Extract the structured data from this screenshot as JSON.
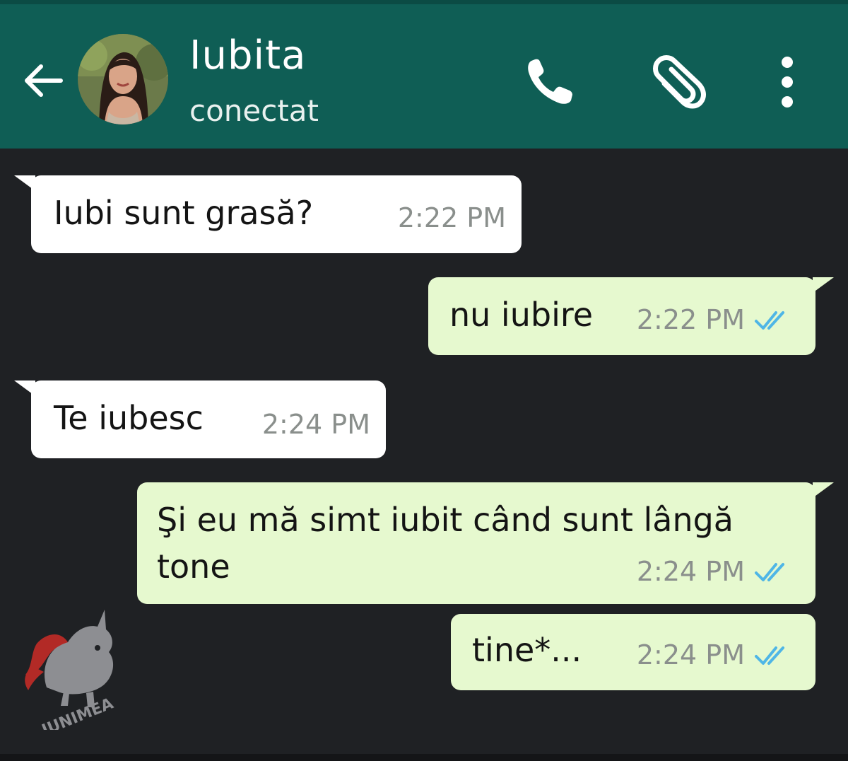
{
  "header": {
    "contact_name": "Iubita",
    "status": "conectat",
    "icons": [
      "back-arrow-icon",
      "phone-icon",
      "paperclip-icon",
      "more-vert-icon"
    ],
    "background_color": "#0f5e55"
  },
  "messages": [
    {
      "direction": "incoming",
      "text": "Iubi sunt grasă?",
      "time": "2:22 PM"
    },
    {
      "direction": "outgoing",
      "text": "nu iubire",
      "time": "2:22 PM",
      "status": "read"
    },
    {
      "direction": "incoming",
      "text": "Te iubesc",
      "time": "2:24 PM"
    },
    {
      "direction": "outgoing",
      "text_line1": "Şi eu mă simt iubit când sunt lângă",
      "text_line2": "tone",
      "time": "2:24 PM",
      "status": "read"
    },
    {
      "direction": "outgoing",
      "text": "tine*...",
      "time": "2:24 PM",
      "status": "read"
    }
  ],
  "colors": {
    "incoming_bubble": "#ffffff",
    "outgoing_bubble": "#e6f9cf",
    "chat_background": "#1f2124",
    "read_ticks": "#4fb6e6"
  },
  "watermark": {
    "text": "JUNIMEA",
    "icon": "unicorn-logo-icon"
  }
}
